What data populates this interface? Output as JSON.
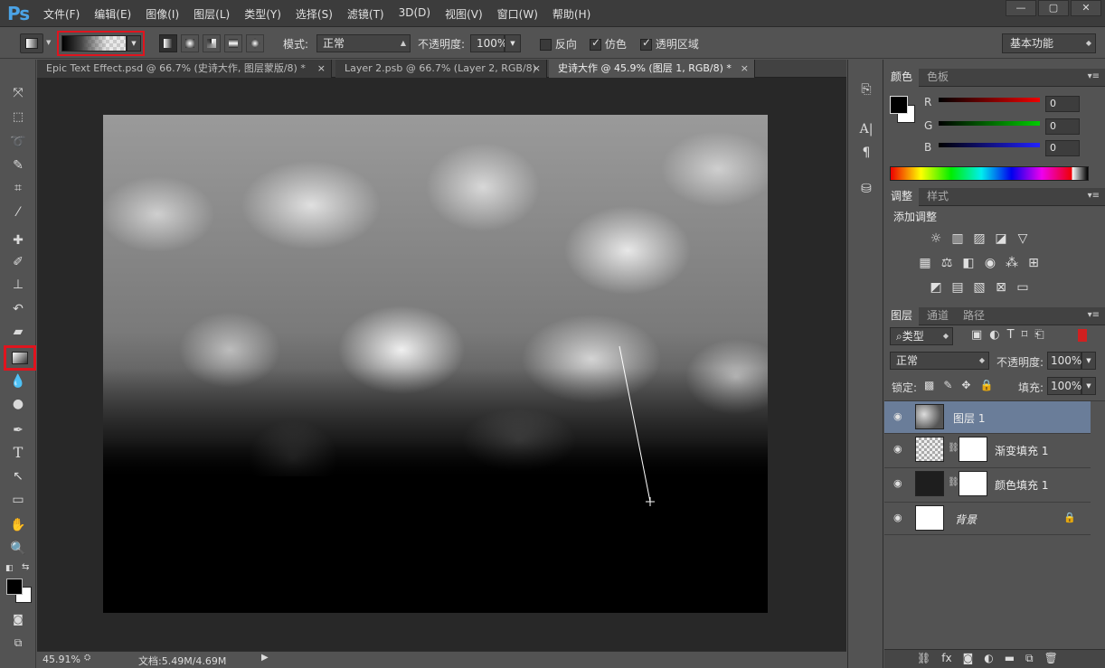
{
  "menubar": {
    "logo": "Ps",
    "items": [
      "文件(F)",
      "编辑(E)",
      "图像(I)",
      "图层(L)",
      "类型(Y)",
      "选择(S)",
      "滤镜(T)",
      "3D(D)",
      "视图(V)",
      "窗口(W)",
      "帮助(H)"
    ],
    "min": "—",
    "max": "▢",
    "close": "✕"
  },
  "options": {
    "mode_label": "模式:",
    "mode_value": "正常",
    "opacity_label": "不透明度:",
    "opacity_value": "100%",
    "reverse": "反向",
    "dither": "仿色",
    "transparency": "透明区域",
    "workspace": "基本功能"
  },
  "tabs": [
    {
      "label": "Epic Text Effect.psd @ 66.7% (史诗大作, 图层蒙版/8) *",
      "close": "×"
    },
    {
      "label": "Layer 2.psb @ 66.7% (Layer 2, RGB/8)",
      "close": "×"
    },
    {
      "label": "史诗大作 @ 45.9% (图层 1, RGB/8) *",
      "close": "×"
    }
  ],
  "status": {
    "zoom": "45.91%",
    "doc": "文档:5.49M/4.69M"
  },
  "color_panel": {
    "tab1": "颜色",
    "tab2": "色板",
    "r_label": "R",
    "g_label": "G",
    "b_label": "B",
    "r": "0",
    "g": "0",
    "b": "0"
  },
  "adjust_panel": {
    "tab1": "调整",
    "tab2": "样式",
    "title": "添加调整"
  },
  "layers_panel": {
    "tab1": "图层",
    "tab2": "通道",
    "tab3": "路径",
    "filter": "类型",
    "blend": "正常",
    "opacity_label": "不透明度:",
    "opacity_value": "100%",
    "lock_label": "锁定:",
    "fill_label": "填充:",
    "fill_value": "100%",
    "layers": [
      {
        "name": "图层 1"
      },
      {
        "name": "渐变填充 1"
      },
      {
        "name": "颜色填充 1"
      },
      {
        "name": "背景"
      }
    ]
  }
}
